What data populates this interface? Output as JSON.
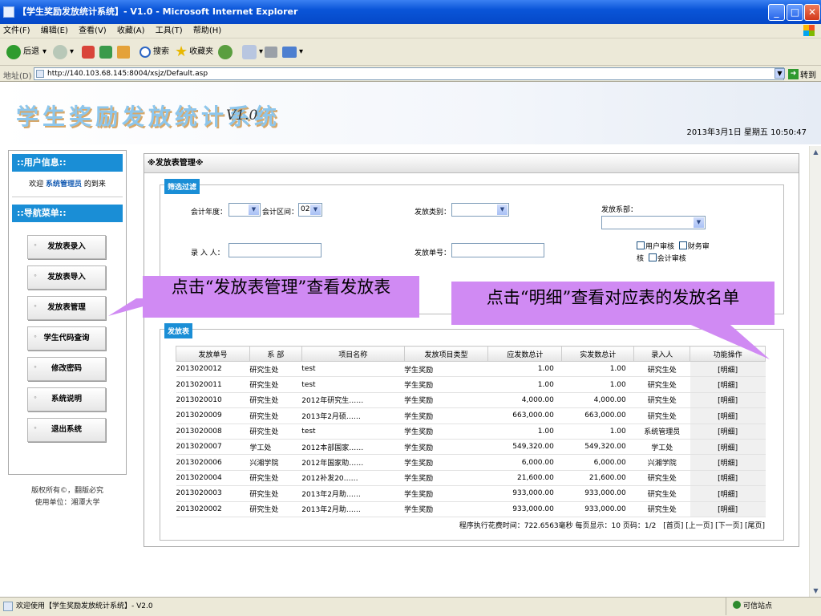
{
  "window": {
    "title": "【学生奖励发放统计系统】- V1.0 - Microsoft Internet Explorer",
    "min": "_",
    "max": "□",
    "close": "✕"
  },
  "menu": [
    "文件(F)",
    "编辑(E)",
    "查看(V)",
    "收藏(A)",
    "工具(T)",
    "帮助(H)"
  ],
  "toolbar": {
    "back": "后退",
    "search": "搜索",
    "favorites": "收藏夹"
  },
  "address": {
    "label": "地址(D)",
    "url": "http://140.103.68.145:8004/xsjz/Default.asp",
    "go": "转到"
  },
  "header": {
    "logo": "学生奖励发放统计系统",
    "version": "V1.0",
    "datetime": "2013年3月1日 星期五 10:50:47"
  },
  "sidebar": {
    "user_head": "::用户信息::",
    "welcome_pre": "欢迎",
    "welcome_user": "系统管理员",
    "welcome_post": "的到来",
    "nav_head": "::导航菜单::",
    "nav": [
      "发放表录入",
      "发放表导入",
      "发放表管理",
      "学生代码查询",
      "修改密码",
      "系统说明",
      "退出系统"
    ],
    "copyright1": "版权所有©，翻版必究",
    "copyright2": "使用单位：湘潭大学"
  },
  "main": {
    "title": "※发放表管理※",
    "filter": {
      "legend": "筛选过滤",
      "year_label": "会计年度：",
      "year_value": "",
      "period_label": "会计区间：",
      "period_value": "02",
      "type_label": "发放类别：",
      "type_value": "",
      "dept_label": "发放系部：",
      "dept_value": "",
      "entry_label": "录 入 人：",
      "entry_value": "",
      "sheet_label": "发放单号：",
      "sheet_value": "",
      "chk_user": "用户审核",
      "chk_fin": "财务审",
      "chk_fin2": "核",
      "chk_acc": "会计审核"
    },
    "table": {
      "legend": "发放表",
      "headers": [
        "发放单号",
        "系 部",
        "项目名称",
        "发放项目类型",
        "应发数总计",
        "实发数总计",
        "录入人",
        "功能操作"
      ],
      "rows": [
        [
          "2013020012",
          "研究生处",
          "test",
          "学生奖励",
          "1.00",
          "1.00",
          "研究生处",
          "[明细]"
        ],
        [
          "2013020011",
          "研究生处",
          "test",
          "学生奖励",
          "1.00",
          "1.00",
          "研究生处",
          "[明细]"
        ],
        [
          "2013020010",
          "研究生处",
          "2012年研究生……",
          "学生奖励",
          "4,000.00",
          "4,000.00",
          "研究生处",
          "[明细]"
        ],
        [
          "2013020009",
          "研究生处",
          "2013年2月硕……",
          "学生奖励",
          "663,000.00",
          "663,000.00",
          "研究生处",
          "[明细]"
        ],
        [
          "2013020008",
          "研究生处",
          "test",
          "学生奖励",
          "1.00",
          "1.00",
          "系统管理员",
          "[明细]"
        ],
        [
          "2013020007",
          "学工处",
          "2012本部国家……",
          "学生奖励",
          "549,320.00",
          "549,320.00",
          "学工处",
          "[明细]"
        ],
        [
          "2013020006",
          "兴湘学院",
          "2012年国家助……",
          "学生奖励",
          "6,000.00",
          "6,000.00",
          "兴湘学院",
          "[明细]"
        ],
        [
          "2013020004",
          "研究生处",
          "2012补发20……",
          "学生奖励",
          "21,600.00",
          "21,600.00",
          "研究生处",
          "[明细]"
        ],
        [
          "2013020003",
          "研究生处",
          "2013年2月助……",
          "学生奖励",
          "933,000.00",
          "933,000.00",
          "研究生处",
          "[明细]"
        ],
        [
          "2013020002",
          "研究生处",
          "2013年2月助……",
          "学生奖励",
          "933,000.00",
          "933,000.00",
          "研究生处",
          "[明细]"
        ]
      ],
      "pager": "程序执行花费时间：722.6563毫秒 每页显示：10 页码：1/2　[首页] [上一页] [下一页] [尾页]"
    }
  },
  "callouts": {
    "left": "点击“发放表管理”查看发放表",
    "right": "点击“明细”查看对应表的发放名单"
  },
  "status": {
    "text": "欢迎使用【学生奖励发放统计系统】- V2.0",
    "zone": "可信站点"
  },
  "colors": {
    "accent": "#1a8ed6",
    "callout": "#d08af3",
    "xp_title": "#0548c8"
  }
}
